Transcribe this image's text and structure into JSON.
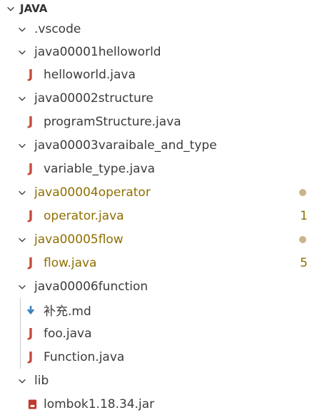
{
  "root": {
    "label": "JAVA"
  },
  "items": [
    {
      "label": ".vscode"
    },
    {
      "label": "java00001helloworld"
    },
    {
      "label": "helloworld.java"
    },
    {
      "label": "java00002structure"
    },
    {
      "label": "programStructure.java"
    },
    {
      "label": "java00003varaibale_and_type"
    },
    {
      "label": "variable_type.java"
    },
    {
      "label": "java00004operator"
    },
    {
      "label": "operator.java",
      "badge": "1"
    },
    {
      "label": "java00005flow"
    },
    {
      "label": "flow.java",
      "badge": "5"
    },
    {
      "label": "java00006function"
    },
    {
      "label": "补充.md"
    },
    {
      "label": "foo.java"
    },
    {
      "label": "Function.java"
    },
    {
      "label": "lib"
    },
    {
      "label": "lombok1.18.34.jar"
    }
  ],
  "colors": {
    "java_icon": "#c74b3a",
    "warning_text": "#8f6f00",
    "modified_dot": "#c9b58a",
    "markdown_icon": "#3b7fb8",
    "jar_icon": "#c0392b"
  }
}
